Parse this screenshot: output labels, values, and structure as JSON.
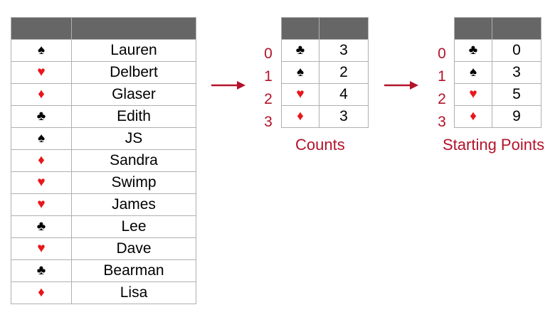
{
  "colors": {
    "red_suit": "#e8161c",
    "black_suit": "#000000",
    "accent": "#b3122a",
    "header": "#666666"
  },
  "suit_glyphs": {
    "spade": "♠",
    "heart": "♥",
    "diamond": "♦",
    "club": "♣"
  },
  "names_table": {
    "rows": [
      {
        "suit": "♠",
        "color": "black",
        "name": "Lauren"
      },
      {
        "suit": "♥",
        "color": "red",
        "name": "Delbert"
      },
      {
        "suit": "♦",
        "color": "red",
        "name": "Glaser"
      },
      {
        "suit": "♣",
        "color": "black",
        "name": "Edith"
      },
      {
        "suit": "♠",
        "color": "black",
        "name": "JS"
      },
      {
        "suit": "♦",
        "color": "red",
        "name": "Sandra"
      },
      {
        "suit": "♥",
        "color": "red",
        "name": "Swimp"
      },
      {
        "suit": "♥",
        "color": "red",
        "name": "James"
      },
      {
        "suit": "♣",
        "color": "black",
        "name": "Lee"
      },
      {
        "suit": "♥",
        "color": "red",
        "name": "Dave"
      },
      {
        "suit": "♣",
        "color": "black",
        "name": "Bearman"
      },
      {
        "suit": "♦",
        "color": "red",
        "name": "Lisa"
      }
    ]
  },
  "counts_table": {
    "caption": "Counts",
    "indices": [
      "0",
      "1",
      "2",
      "3"
    ],
    "rows": [
      {
        "suit": "♣",
        "color": "black",
        "value": "3"
      },
      {
        "suit": "♠",
        "color": "black",
        "value": "2"
      },
      {
        "suit": "♥",
        "color": "red",
        "value": "4"
      },
      {
        "suit": "♦",
        "color": "red",
        "value": "3"
      }
    ]
  },
  "starts_table": {
    "caption": "Starting Points",
    "indices": [
      "0",
      "1",
      "2",
      "3"
    ],
    "rows": [
      {
        "suit": "♣",
        "color": "black",
        "value": "0"
      },
      {
        "suit": "♠",
        "color": "black",
        "value": "3"
      },
      {
        "suit": "♥",
        "color": "red",
        "value": "5"
      },
      {
        "suit": "♦",
        "color": "red",
        "value": "9"
      }
    ]
  }
}
